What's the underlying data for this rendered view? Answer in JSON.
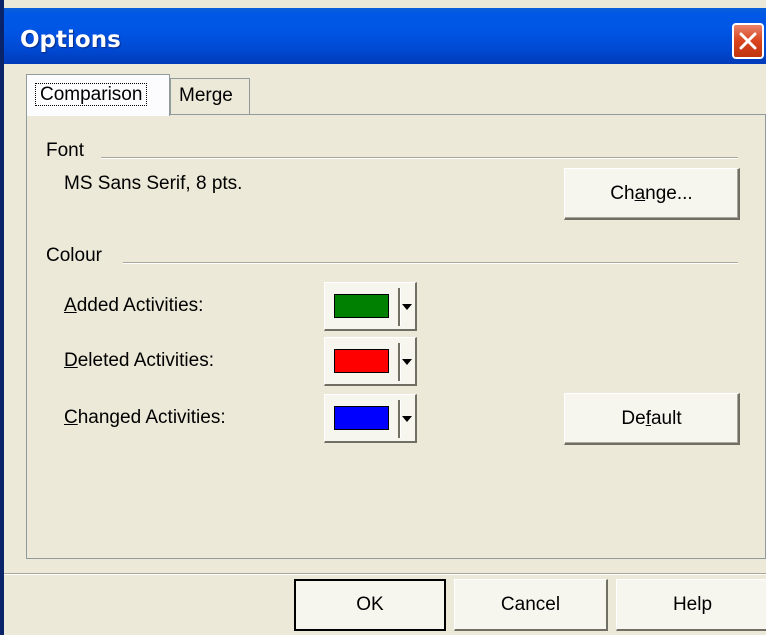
{
  "window": {
    "title": "Options"
  },
  "tabs": [
    {
      "label": "Comparison",
      "active": true
    },
    {
      "label": "Merge",
      "active": false
    }
  ],
  "font_group": {
    "label": "Font",
    "value": "MS Sans Serif, 8 pts.",
    "change_button": {
      "pre": "Ch",
      "mnemonic": "a",
      "post": "nge..."
    }
  },
  "colour_group": {
    "label": "Colour",
    "rows": [
      {
        "mnemonic": "A",
        "rest": "dded Activities:",
        "color": "#008000"
      },
      {
        "mnemonic": "D",
        "rest": "eleted Activities:",
        "color": "#FF0000"
      },
      {
        "mnemonic": "C",
        "rest": "hanged Activities:",
        "color": "#0000FF"
      }
    ],
    "default_button": {
      "pre": "De",
      "mnemonic": "f",
      "post": "ault"
    }
  },
  "buttons": {
    "ok": "OK",
    "cancel": "Cancel",
    "help": "Help"
  },
  "colors": {
    "titlebar": "#0055E5",
    "dialog_bg": "#ECE9D8",
    "close_red": "#D9441E"
  }
}
